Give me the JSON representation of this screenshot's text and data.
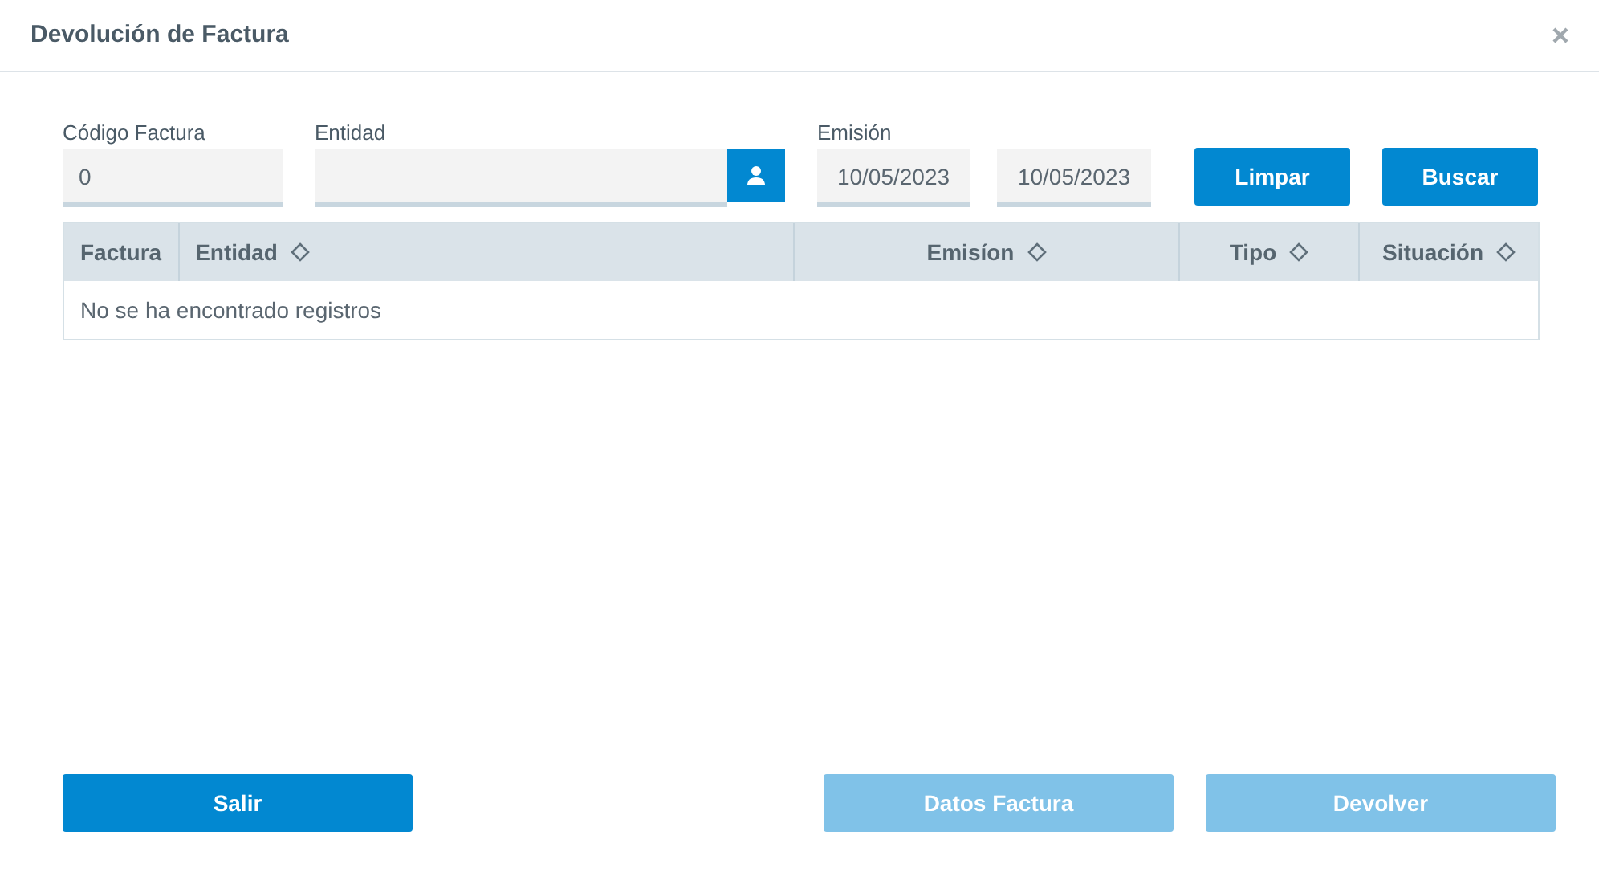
{
  "window": {
    "title": "Devolución de Factura"
  },
  "filters": {
    "codigo": {
      "label": "Código Factura",
      "value": "0"
    },
    "entidad": {
      "label": "Entidad"
    },
    "emision": {
      "label": "Emisión",
      "from": "10/05/2023",
      "to": "10/05/2023"
    }
  },
  "filter_buttons": [
    {
      "label": "Limpar",
      "disabled": false
    },
    {
      "label": "Buscar",
      "disabled": false
    }
  ],
  "table": {
    "columns": [
      {
        "label": "Factura",
        "sortable": false
      },
      {
        "label": "Entidad",
        "sortable": true
      },
      {
        "label": "Emisíon",
        "sortable": true
      },
      {
        "label": "Tipo",
        "sortable": true
      },
      {
        "label": "Situación",
        "sortable": true
      }
    ],
    "empty_message": "No se ha encontrado registros"
  },
  "footer_buttons": [
    {
      "label": "Salir",
      "disabled": false
    },
    {
      "label": "Datos Factura",
      "disabled": true
    },
    {
      "label": "Devolver",
      "disabled": true
    }
  ]
}
